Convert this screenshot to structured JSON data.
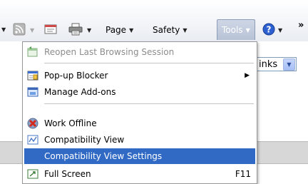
{
  "toolbar": {
    "page_label": "Page",
    "safety_label": "Safety",
    "tools_label": "Tools",
    "more_label": "»",
    "icons": [
      "feeds-icon",
      "read-mail-icon",
      "print-icon",
      "help-icon"
    ]
  },
  "page": {
    "links_select_value": "inks"
  },
  "menu": {
    "items": [
      {
        "label": "Reopen Last Browsing Session",
        "enabled": false,
        "icon": "reopen-session-icon"
      },
      {
        "label": "Pop-up Blocker",
        "submenu": true,
        "icon": "popup-blocker-icon"
      },
      {
        "label": "Manage Add-ons",
        "icon": "manage-addons-icon"
      },
      {
        "label": "Work Offline",
        "icon": "work-offline-icon"
      },
      {
        "label": "Compatibility View",
        "icon": "compatibility-view-icon"
      },
      {
        "label": "Compatibility View Settings",
        "selected": true
      },
      {
        "label": "Full Screen",
        "shortcut": "F11",
        "icon": "full-screen-icon"
      }
    ]
  },
  "colors": {
    "selection": "#316ac5",
    "menu_border": "#979797",
    "disabled_text": "#8c8c8c"
  }
}
